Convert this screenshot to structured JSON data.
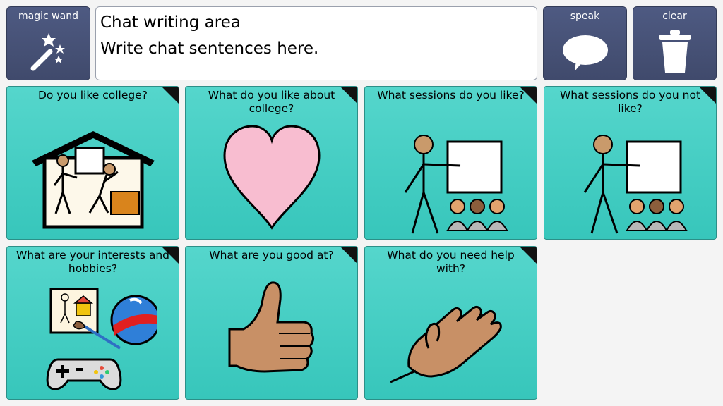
{
  "toolbar": {
    "magic_wand_label": "magic wand",
    "speak_label": "speak",
    "clear_label": "clear"
  },
  "chat": {
    "title": "Chat writing area",
    "text": "Write chat sentences here."
  },
  "tiles": [
    {
      "label": "Do you like college?",
      "icon": "college-house-icon"
    },
    {
      "label": "What do you like about college?",
      "icon": "heart-icon"
    },
    {
      "label": "What sessions do you like?",
      "icon": "teacher-whiteboard-icon"
    },
    {
      "label": "What sessions do you not like?",
      "icon": "teacher-whiteboard-icon"
    },
    {
      "label": "What are your interests and hobbies?",
      "icon": "hobbies-icon"
    },
    {
      "label": "What are you good at?",
      "icon": "thumbs-up-icon"
    },
    {
      "label": "What do you need help with?",
      "icon": "helping-hand-icon"
    }
  ],
  "colors": {
    "toolbar_button": "#48537a",
    "tile": "#46cec3",
    "background": "#f4f4f4"
  }
}
